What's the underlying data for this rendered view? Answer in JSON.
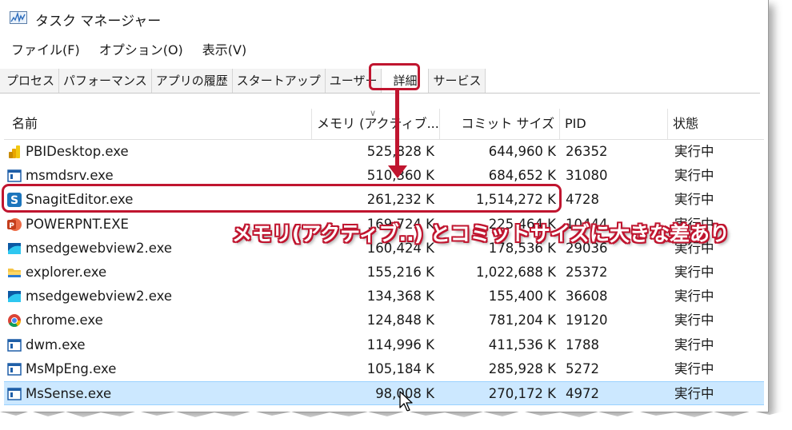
{
  "window": {
    "title": "タスク マネージャー",
    "icon": "performance-graph-icon"
  },
  "menu": [
    "ファイル(F)",
    "オプション(O)",
    "表示(V)"
  ],
  "tabs": [
    "プロセス",
    "パフォーマンス",
    "アプリの履歴",
    "スタートアップ",
    "ユーザー",
    "詳細",
    "サービス"
  ],
  "active_tab": "詳細",
  "columns": {
    "name": "名前",
    "memory": "メモリ (アクティブ...",
    "commit": "コミット サイズ",
    "pid": "PID",
    "status": "状態"
  },
  "rows": [
    {
      "name": "PBIDesktop.exe",
      "memory": "525,828 K",
      "commit": "644,960 K",
      "pid": "26352",
      "status": "実行中",
      "icon": "power-bi-icon"
    },
    {
      "name": "msmdsrv.exe",
      "memory": "510,360 K",
      "commit": "684,652 K",
      "pid": "31080",
      "status": "実行中",
      "icon": "window-app-icon"
    },
    {
      "name": "SnagitEditor.exe",
      "memory": "261,232 K",
      "commit": "1,514,272 K",
      "pid": "4728",
      "status": "実行中",
      "icon": "snagit-icon"
    },
    {
      "name": "POWERPNT.EXE",
      "memory": "169,724 K",
      "commit": "225,464 K",
      "pid": "10444",
      "status": "実行中",
      "icon": "powerpoint-icon"
    },
    {
      "name": "msedgewebview2.exe",
      "memory": "160,424 K",
      "commit": "178,536 K",
      "pid": "29036",
      "status": "実行中",
      "icon": "edge-webview-icon"
    },
    {
      "name": "explorer.exe",
      "memory": "155,216 K",
      "commit": "1,022,688 K",
      "pid": "25372",
      "status": "実行中",
      "icon": "folder-icon"
    },
    {
      "name": "msedgewebview2.exe",
      "memory": "134,368 K",
      "commit": "155,400 K",
      "pid": "36608",
      "status": "実行中",
      "icon": "edge-webview-icon"
    },
    {
      "name": "chrome.exe",
      "memory": "124,848 K",
      "commit": "781,204 K",
      "pid": "19120",
      "status": "実行中",
      "icon": "chrome-icon"
    },
    {
      "name": "dwm.exe",
      "memory": "114,996 K",
      "commit": "411,536 K",
      "pid": "1788",
      "status": "実行中",
      "icon": "window-app-icon"
    },
    {
      "name": "MsMpEng.exe",
      "memory": "105,184 K",
      "commit": "285,928 K",
      "pid": "5272",
      "status": "実行中",
      "icon": "window-app-icon"
    },
    {
      "name": "MsSense.exe",
      "memory": "98,008 K",
      "commit": "270,172 K",
      "pid": "4972",
      "status": "実行中",
      "icon": "window-app-icon"
    }
  ],
  "selected_row": "MsSense.exe",
  "annotation": {
    "callout": "メモリ(アクティブ..) とコミットサイズに大きな差あり",
    "highlight_color": "#c0152f"
  }
}
